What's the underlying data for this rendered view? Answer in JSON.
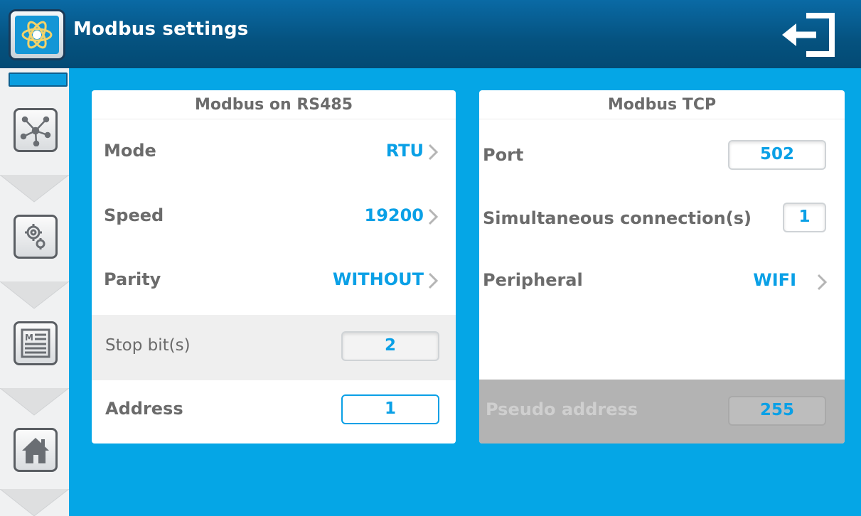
{
  "header": {
    "title": "Modbus settings",
    "logo_icon": "atom-icon",
    "exit_icon": "exit-icon"
  },
  "sidebar": {
    "indicator_color": "#0a9ee0",
    "items": [
      {
        "icon": "network-icon"
      },
      {
        "icon": "settings-gears-icon"
      },
      {
        "icon": "menu-list-icon"
      },
      {
        "icon": "home-icon"
      }
    ]
  },
  "rs485": {
    "title": "Modbus on RS485",
    "mode": {
      "label": "Mode",
      "value": "RTU"
    },
    "speed": {
      "label": "Speed",
      "value": "19200"
    },
    "parity": {
      "label": "Parity",
      "value": "WITHOUT"
    },
    "stop_bits": {
      "label": "Stop bit(s)",
      "value": "2"
    },
    "address": {
      "label": "Address",
      "value": "1"
    }
  },
  "tcp": {
    "title": "Modbus TCP",
    "port": {
      "label": "Port",
      "value": "502"
    },
    "connections": {
      "label": "Simultaneous connection(s)",
      "value": "1"
    },
    "peripheral": {
      "label": "Peripheral",
      "value": "WIFI"
    },
    "pseudo_address": {
      "label": "Pseudo address",
      "value": "255"
    }
  },
  "colors": {
    "accent": "#0aa0e6",
    "background": "#05a6e6",
    "header": "#05527f",
    "label": "#6b6b6b"
  }
}
